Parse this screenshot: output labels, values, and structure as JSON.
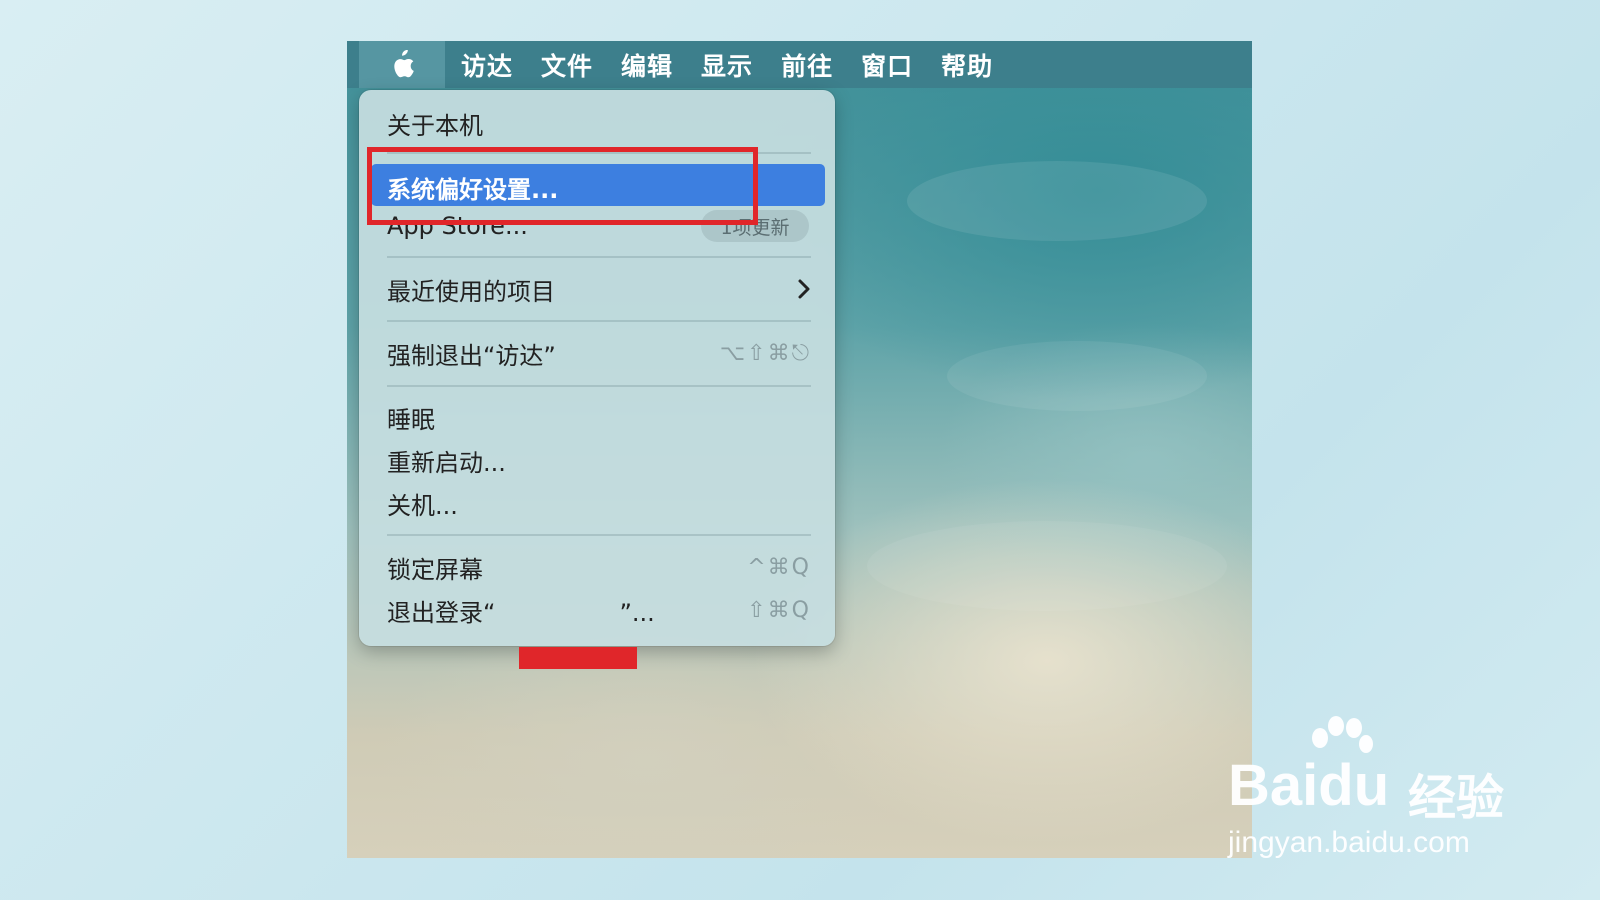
{
  "menubar": {
    "apple_icon": "apple-logo",
    "items": [
      "访达",
      "文件",
      "编辑",
      "显示",
      "前往",
      "窗口",
      "帮助"
    ]
  },
  "apple_menu": {
    "about": "关于本机",
    "system_prefs": "系统偏好设置...",
    "app_store": "App Store...",
    "app_store_badge": "1项更新",
    "recent_items": "最近使用的项目",
    "force_quit": "强制退出“访达”",
    "force_quit_shortcut": "⌥⇧⌘⎋",
    "sleep": "睡眠",
    "restart": "重新启动...",
    "shutdown": "关机...",
    "lock_screen": "锁定屏幕",
    "lock_screen_shortcut": "^⌘Q",
    "logout_prefix": "退出登录“",
    "logout_suffix": "”...",
    "logout_shortcut": "⇧⌘Q"
  },
  "watermark": {
    "logo_text": "Bai",
    "logo_du": "du",
    "cn": "经验",
    "url": "jingyan.baidu.com"
  },
  "colors": {
    "highlight": "#3d7fe0",
    "annotation": "#e0262a",
    "menubar": "#3d7f8c"
  }
}
